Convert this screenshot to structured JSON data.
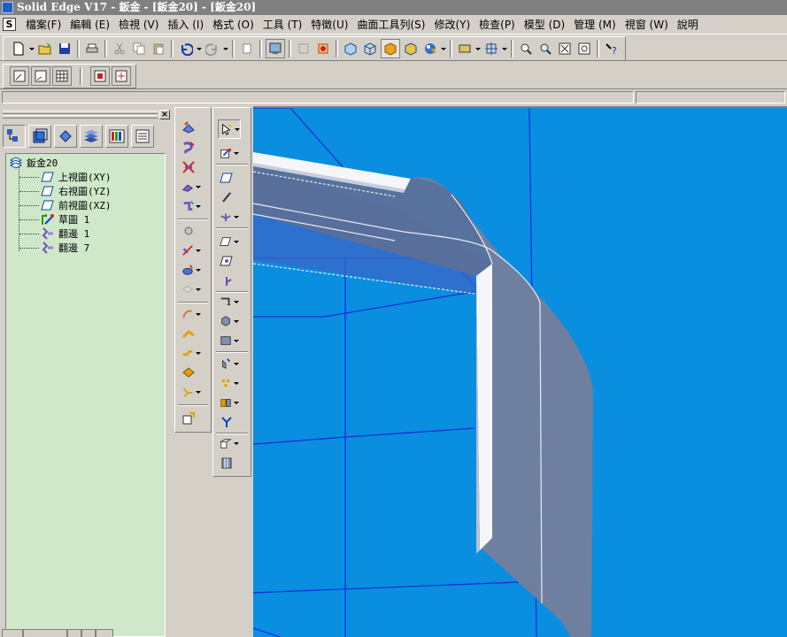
{
  "window": {
    "title": "Solid Edge V17 - 鈑金 - [鈑金20] - [鈑金20]"
  },
  "menu": {
    "items": [
      "檔案(F)",
      "編輯 (E)",
      "檢視 (V)",
      "插入 (I)",
      "格式 (O)",
      "工具 (T)",
      "特徵(U)",
      "曲面工具列(S)",
      "修改(Y)",
      "檢查(P)",
      "模型 (D)",
      "管理 (M)",
      "視窗 (W)",
      "說明"
    ]
  },
  "toolbar": {
    "icons": [
      "new-icon",
      "open-icon",
      "save-icon",
      "print-icon",
      "cut-icon",
      "copy-icon",
      "paste-icon",
      "undo-icon",
      "redo-icon",
      "paste-special-icon",
      "display-icon",
      "select-icon",
      "select-add-icon",
      "iso-view-icon",
      "wireframe-icon",
      "shaded-icon",
      "shaded-edges-icon",
      "render-icon",
      "views-icon",
      "fit-icon",
      "zoom-area-icon",
      "zoom-icon",
      "fit-all-icon",
      "spin-icon",
      "help-icon"
    ]
  },
  "toolbar2": {
    "icons": [
      "sketch-icon",
      "plane-icon",
      "grid-icon",
      "intellisketch-icon",
      "relations-icon"
    ]
  },
  "tree": {
    "root": "鈑金20",
    "items": [
      "上視圖(XY)",
      "右視圖(YZ)",
      "前視圖(XZ)",
      "草圖 1",
      "翻邊 1",
      "翻邊 7"
    ]
  },
  "colors": {
    "viewport_bg": "#0a8ee0",
    "tree_bg": "#cee8c9",
    "part_face": "#6e7fa0",
    "part_highlight": "#e8ecf4",
    "plane_line": "#1a2bd6"
  }
}
